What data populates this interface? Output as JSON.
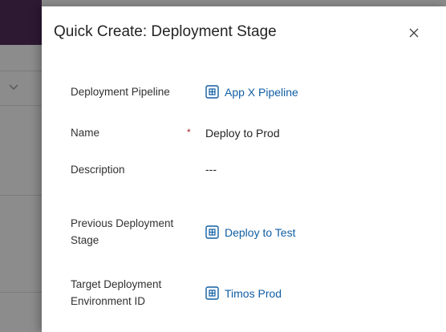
{
  "dialog": {
    "title": "Quick Create: Deployment Stage",
    "close_icon": "close-icon"
  },
  "fields": {
    "pipeline": {
      "label": "Deployment Pipeline",
      "value": "App X Pipeline",
      "icon": "entity-record-icon"
    },
    "name": {
      "label": "Name",
      "required_marker": "*",
      "value": "Deploy to Prod"
    },
    "description": {
      "label": "Description",
      "value": "---"
    },
    "previous_stage": {
      "label": "Previous Deployment Stage",
      "value": "Deploy to Test",
      "icon": "entity-record-icon"
    },
    "target_env": {
      "label": "Target Deployment Environment ID",
      "value": "Timos Prod",
      "icon": "entity-record-icon"
    }
  },
  "colors": {
    "link": "#115ea3",
    "required": "#a4262c",
    "header_dark": "#2e1933",
    "overlay": "#8c8c8c"
  }
}
